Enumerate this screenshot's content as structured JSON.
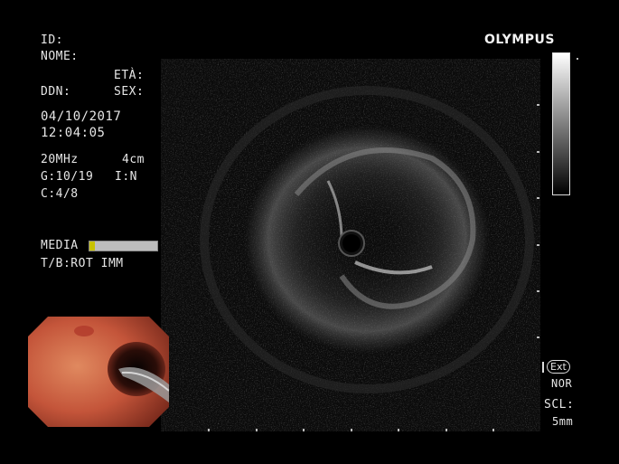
{
  "brand": "OLYMPUS",
  "patient": {
    "id_label": "ID:",
    "name_label": "NOME:",
    "age_label": "ETÀ:",
    "dob_label": "DDN:",
    "sex_label": "SEX:",
    "date": "04/10/2017",
    "time": "12:04:05"
  },
  "settings": {
    "frequency": "20MHz",
    "depth": "4cm",
    "gain": "G:10/19",
    "mode": "I:N",
    "contrast": "C:4/8",
    "media_label": "MEDIA",
    "media_level": 0.08,
    "rotation": "T/B:ROT IMM"
  },
  "bottom_right": {
    "ext_label": "Ext",
    "nor_label": "NOR",
    "scl_label": "SCL:",
    "scl_value": "5mm"
  },
  "colors": {
    "background": "#000000",
    "text": "#e6e6e6",
    "media_fill": "#c8c200"
  },
  "icons": {
    "ext_badge": "ext-icon",
    "transducer": "transducer-core-icon"
  }
}
